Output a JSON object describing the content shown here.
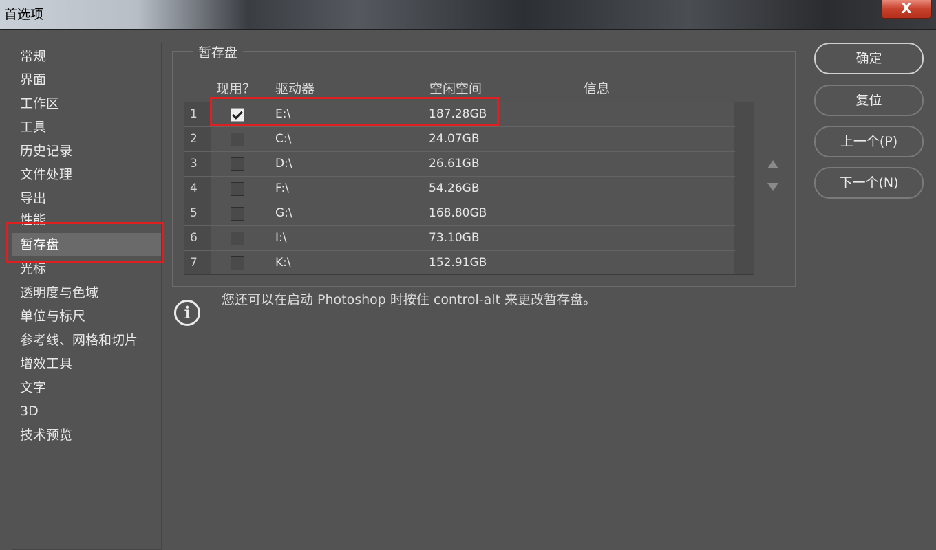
{
  "window": {
    "title": "首选项",
    "close_label": "X"
  },
  "sidebar": {
    "items": [
      {
        "label": "常规"
      },
      {
        "label": "界面"
      },
      {
        "label": "工作区"
      },
      {
        "label": "工具"
      },
      {
        "label": "历史记录"
      },
      {
        "label": "文件处理"
      },
      {
        "label": "导出"
      },
      {
        "label": "性能"
      },
      {
        "label": "暂存盘",
        "selected": true
      },
      {
        "label": "光标"
      },
      {
        "label": "透明度与色域"
      },
      {
        "label": "单位与标尺"
      },
      {
        "label": "参考线、网格和切片"
      },
      {
        "label": "增效工具"
      },
      {
        "label": "文字"
      },
      {
        "label": "3D"
      },
      {
        "label": "技术预览"
      }
    ]
  },
  "scratch": {
    "title": "暂存盘",
    "headers": {
      "active": "现用？",
      "drive": "驱动器",
      "free_space": "空闲空间",
      "info": "信息"
    },
    "rows": [
      {
        "num": "1",
        "checked": true,
        "drive": "E:\\",
        "space": "187.28GB"
      },
      {
        "num": "2",
        "checked": false,
        "drive": "C:\\",
        "space": "24.07GB"
      },
      {
        "num": "3",
        "checked": false,
        "drive": "D:\\",
        "space": "26.61GB"
      },
      {
        "num": "4",
        "checked": false,
        "drive": "F:\\",
        "space": "54.26GB"
      },
      {
        "num": "5",
        "checked": false,
        "drive": "G:\\",
        "space": "168.80GB"
      },
      {
        "num": "6",
        "checked": false,
        "drive": "I:\\",
        "space": "73.10GB"
      },
      {
        "num": "7",
        "checked": false,
        "drive": "K:\\",
        "space": "152.91GB"
      }
    ],
    "info_text": "您还可以在启动 Photoshop 时按住 control-alt 来更改暂存盘。"
  },
  "buttons": {
    "ok": "确定",
    "reset": "复位",
    "prev": "上一个(P)",
    "next": "下一个(N)"
  },
  "colors": {
    "background": "#535353",
    "highlight": "#e02020",
    "selected_item": "#6a6a6a"
  }
}
